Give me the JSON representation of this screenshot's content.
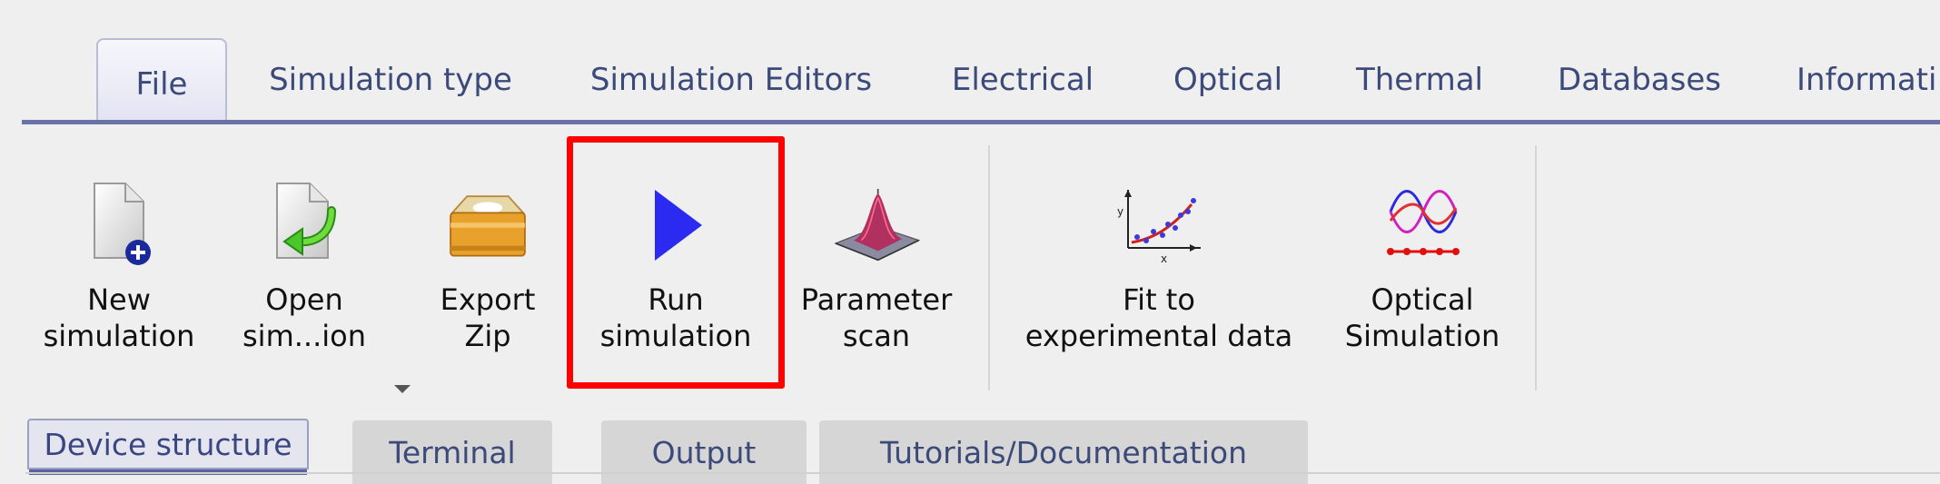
{
  "main_tabs": [
    {
      "label": "File",
      "active": true
    },
    {
      "label": "Simulation type"
    },
    {
      "label": "Simulation Editors"
    },
    {
      "label": "Electrical"
    },
    {
      "label": "Optical"
    },
    {
      "label": "Thermal"
    },
    {
      "label": "Databases"
    },
    {
      "label": "Informati"
    }
  ],
  "ribbon": {
    "buttons": [
      {
        "line1": "New",
        "line2": "simulation",
        "icon": "new-document-icon"
      },
      {
        "line1": "Open",
        "line2": "sim...ion",
        "icon": "open-document-icon"
      },
      {
        "line1": "Export",
        "line2": "Zip",
        "icon": "box-icon"
      },
      {
        "line1": "Run",
        "line2": "simulation",
        "icon": "play-icon"
      },
      {
        "line1": "Parameter",
        "line2": "scan",
        "icon": "surface-plot-icon"
      },
      {
        "line1": "Fit to",
        "line2": "experimental data",
        "icon": "curve-fit-icon"
      },
      {
        "line1": "Optical",
        "line2": "Simulation",
        "icon": "optical-waves-icon"
      }
    ],
    "highlight_color": "#ff0000",
    "play_color": "#2a2af0"
  },
  "bottom_tabs": [
    {
      "label": "Device structure",
      "active": true
    },
    {
      "label": "Terminal"
    },
    {
      "label": "Output"
    },
    {
      "label": "Tutorials/Documentation"
    }
  ]
}
